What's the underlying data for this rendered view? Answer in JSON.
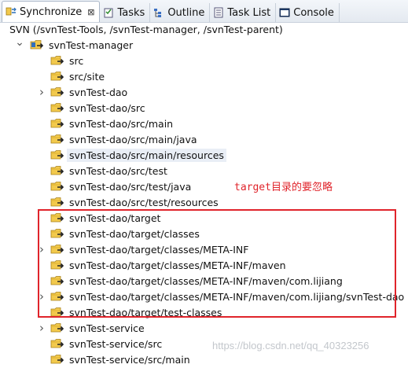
{
  "tabs": [
    {
      "label": "Synchronize",
      "icon": "synchronize-icon",
      "active": true,
      "close": "⊠"
    },
    {
      "label": "Tasks",
      "icon": "tasks-icon"
    },
    {
      "label": "Outline",
      "icon": "outline-icon"
    },
    {
      "label": "Task List",
      "icon": "task-list-icon"
    },
    {
      "label": "Console",
      "icon": "console-icon"
    }
  ],
  "header": "SVN (/svnTest-Tools, /svnTest-manager, /svnTest-parent)",
  "tree": [
    {
      "label": "svnTest-manager",
      "kind": "project",
      "twisty": "expanded"
    },
    {
      "label": "src"
    },
    {
      "label": "src/site"
    },
    {
      "label": "svnTest-dao",
      "twisty": "collapsed"
    },
    {
      "label": "svnTest-dao/src"
    },
    {
      "label": "svnTest-dao/src/main"
    },
    {
      "label": "svnTest-dao/src/main/java"
    },
    {
      "label": "svnTest-dao/src/main/resources",
      "selected": true
    },
    {
      "label": "svnTest-dao/src/test"
    },
    {
      "label": "svnTest-dao/src/test/java"
    },
    {
      "label": "svnTest-dao/src/test/resources"
    },
    {
      "label": "svnTest-dao/target"
    },
    {
      "label": "svnTest-dao/target/classes"
    },
    {
      "label": "svnTest-dao/target/classes/META-INF",
      "twisty": "collapsed"
    },
    {
      "label": "svnTest-dao/target/classes/META-INF/maven"
    },
    {
      "label": "svnTest-dao/target/classes/META-INF/maven/com.lijiang"
    },
    {
      "label": "svnTest-dao/target/classes/META-INF/maven/com.lijiang/svnTest-dao",
      "twisty": "collapsed"
    },
    {
      "label": "svnTest-dao/target/test-classes"
    },
    {
      "label": "svnTest-service",
      "twisty": "collapsed"
    },
    {
      "label": "svnTest-service/src"
    },
    {
      "label": "svnTest-service/src/main"
    }
  ],
  "annotation": "target目录的要忽略",
  "watermark": "https://blog.csdn.net/qq_40323256",
  "colors": {
    "annotation": "#e0242b",
    "folder": "#f2c94c",
    "outgoing_arrow": "#222222"
  }
}
